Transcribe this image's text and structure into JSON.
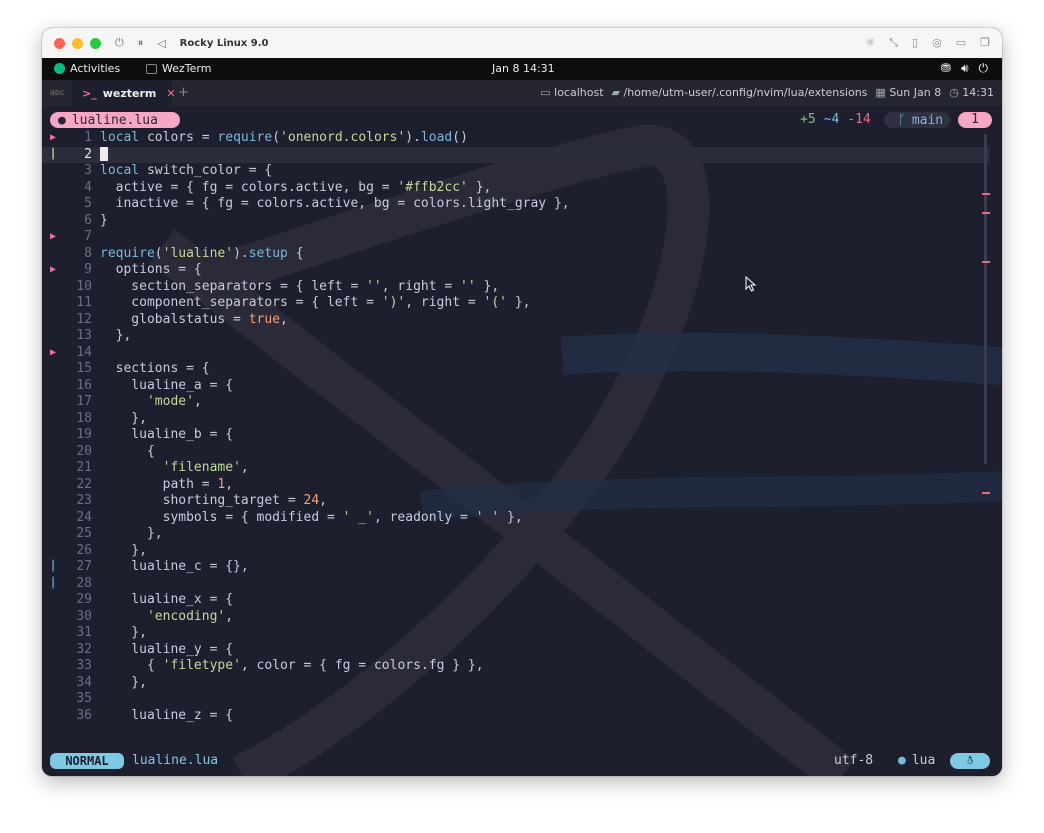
{
  "vm_window": {
    "title": "Rocky Linux 9.0",
    "controls": [
      "power-icon",
      "pause-icon",
      "back-icon"
    ],
    "right_icons": [
      "brightness-icon",
      "resize-icon",
      "usb-icon",
      "disk-icon",
      "folder-icon",
      "windows-icon"
    ]
  },
  "gnome_bar": {
    "activities": "Activities",
    "app_name": "WezTerm",
    "clock": "Jan 8  14:31",
    "system_icons": [
      "network-icon",
      "volume-icon",
      "power-icon"
    ]
  },
  "wezterm": {
    "abc": "abc",
    "tab": {
      "prompt": ">_",
      "name": "wezterm",
      "close": "✕"
    },
    "new_tab": "+",
    "status": {
      "host": "localhost",
      "path": "/home/utm-user/.config/nvim/lua/extensions",
      "date": "Sun Jan 8",
      "time": "14:31"
    }
  },
  "editor": {
    "winbar": {
      "filename": "lualine.lua",
      "diff_add": "+5",
      "diff_mod": "~4",
      "diff_del": "-14",
      "branch": "main",
      "buffer_count": "1"
    },
    "lines": [
      {
        "n": "1",
        "sign": "arrow",
        "code": "local colors = require('onenord.colors').load()"
      },
      {
        "n": "2",
        "sign": "bar",
        "code": "",
        "current": true
      },
      {
        "n": "3",
        "sign": "",
        "code": "local switch_color = {"
      },
      {
        "n": "4",
        "sign": "",
        "code": "  active = { fg = colors.active, bg = '#ffb2cc' },"
      },
      {
        "n": "5",
        "sign": "",
        "code": "  inactive = { fg = colors.active, bg = colors.light_gray },"
      },
      {
        "n": "6",
        "sign": "",
        "code": "}"
      },
      {
        "n": "7",
        "sign": "arrow",
        "code": ""
      },
      {
        "n": "8",
        "sign": "",
        "code": "require('lualine').setup {"
      },
      {
        "n": "9",
        "sign": "arrow",
        "code": "  options = {"
      },
      {
        "n": "10",
        "sign": "",
        "code": "    section_separators = { left = '', right = '' },"
      },
      {
        "n": "11",
        "sign": "",
        "code": "    component_separators = { left = ')', right = '(' },"
      },
      {
        "n": "12",
        "sign": "",
        "code": "    globalstatus = true,"
      },
      {
        "n": "13",
        "sign": "",
        "code": "  },"
      },
      {
        "n": "14",
        "sign": "arrow",
        "code": ""
      },
      {
        "n": "15",
        "sign": "",
        "code": "  sections = {"
      },
      {
        "n": "16",
        "sign": "",
        "code": "    lualine_a = {"
      },
      {
        "n": "17",
        "sign": "",
        "code": "      'mode',"
      },
      {
        "n": "18",
        "sign": "",
        "code": "    },"
      },
      {
        "n": "19",
        "sign": "",
        "code": "    lualine_b = {"
      },
      {
        "n": "20",
        "sign": "",
        "code": "      {"
      },
      {
        "n": "21",
        "sign": "",
        "code": "        'filename',"
      },
      {
        "n": "22",
        "sign": "",
        "code": "        path = 1,"
      },
      {
        "n": "23",
        "sign": "",
        "code": "        shorting_target = 24,"
      },
      {
        "n": "24",
        "sign": "",
        "code": "        symbols = { modified = ' _', readonly = ' ' },"
      },
      {
        "n": "25",
        "sign": "",
        "code": "      },"
      },
      {
        "n": "26",
        "sign": "",
        "code": "    },"
      },
      {
        "n": "27",
        "sign": "barblue",
        "code": "    lualine_c = {},"
      },
      {
        "n": "28",
        "sign": "barblue",
        "code": ""
      },
      {
        "n": "29",
        "sign": "",
        "code": "    lualine_x = {"
      },
      {
        "n": "30",
        "sign": "",
        "code": "      'encoding',"
      },
      {
        "n": "31",
        "sign": "",
        "code": "    },"
      },
      {
        "n": "32",
        "sign": "",
        "code": "    lualine_y = {"
      },
      {
        "n": "33",
        "sign": "",
        "code": "      { 'filetype', color = { fg = colors.fg } },"
      },
      {
        "n": "34",
        "sign": "",
        "code": "    },"
      },
      {
        "n": "35",
        "sign": "",
        "code": ""
      },
      {
        "n": "36",
        "sign": "",
        "code": "    lualine_z = {"
      }
    ],
    "statusline": {
      "mode": "NORMAL",
      "filename": "lualine.lua",
      "encoding": "utf-8",
      "filetype": "lua"
    }
  },
  "colors": {
    "bg": "#1e1f2e",
    "accent_pink": "#f7a6c3",
    "accent_cyan": "#7ec9e3",
    "string": "#c4d89a",
    "keyword": "#7bb8d8"
  }
}
